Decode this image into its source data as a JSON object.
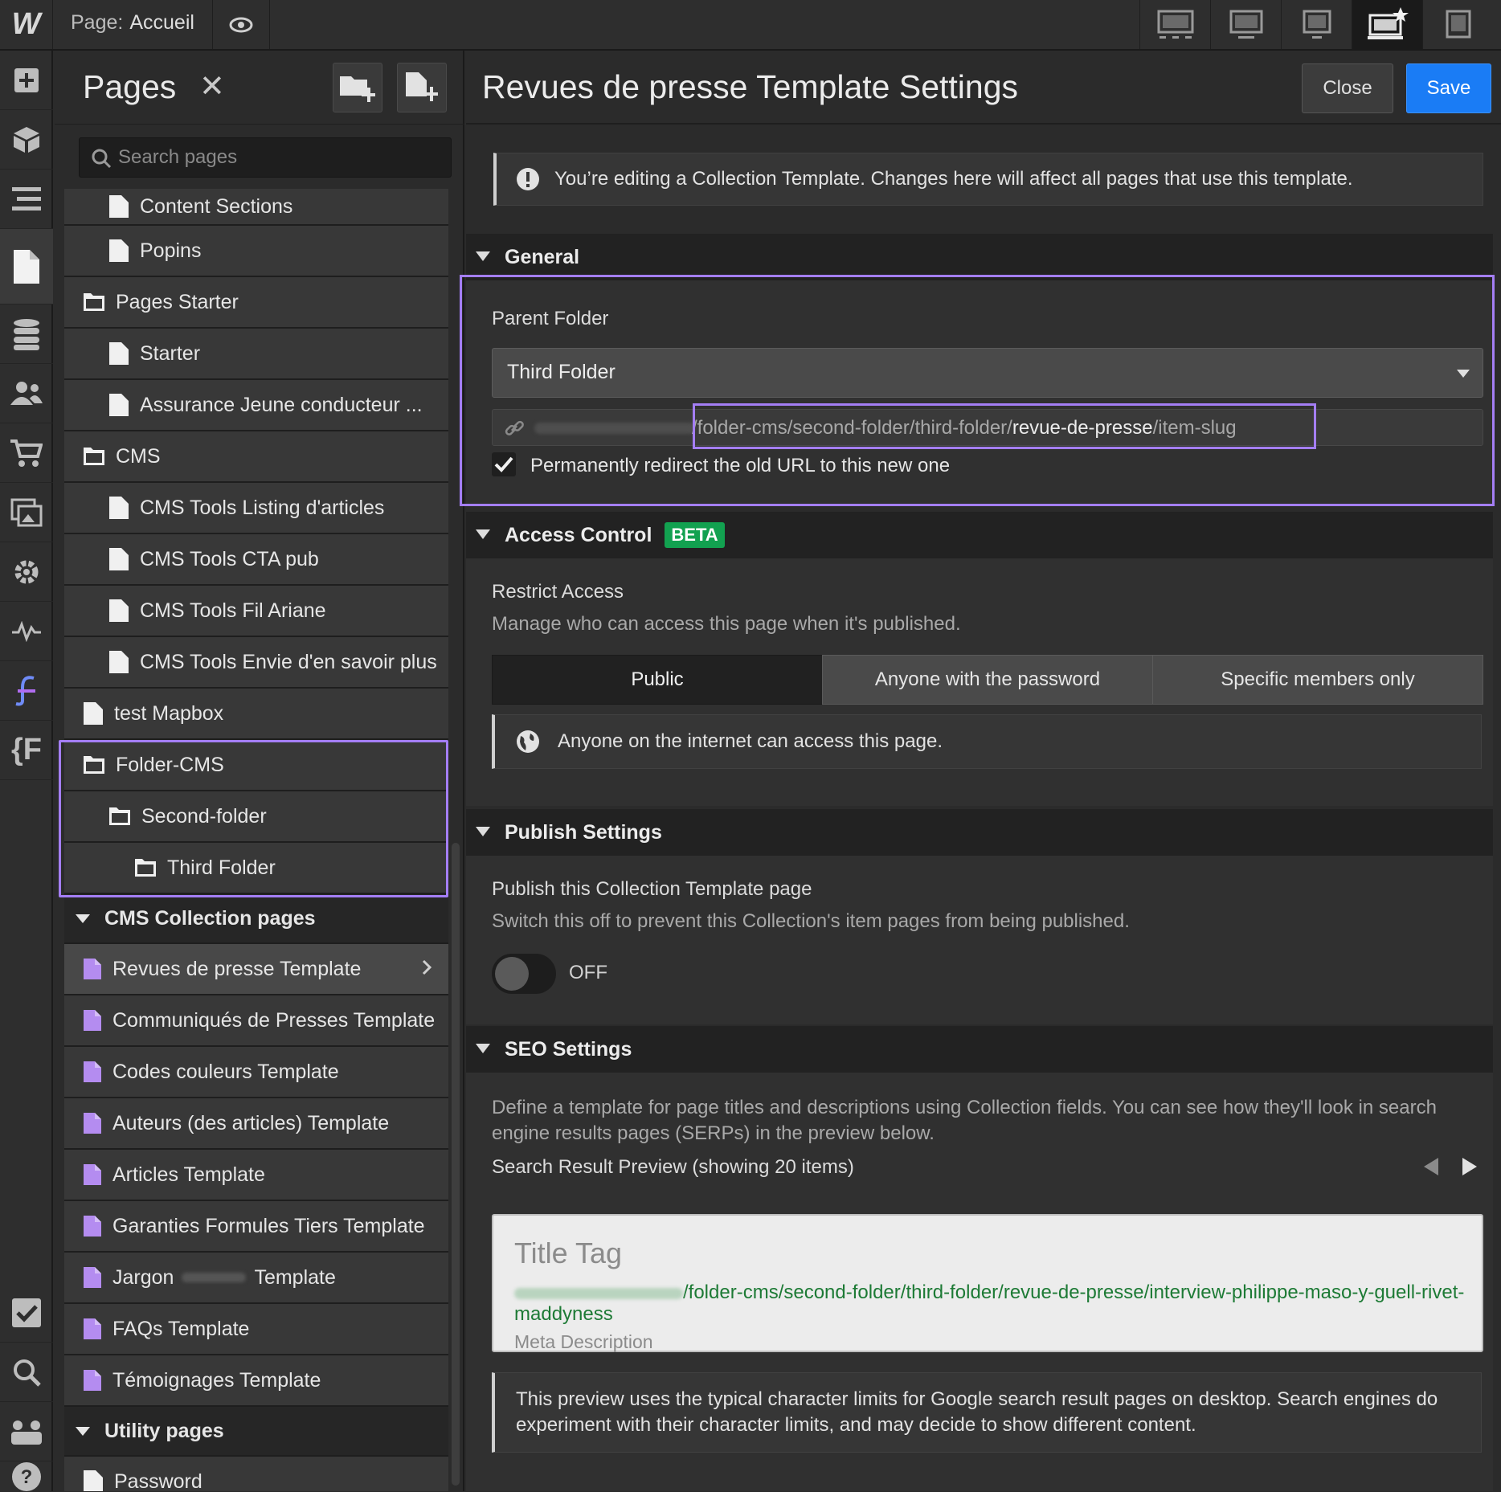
{
  "topbar": {
    "logo": "W",
    "page_prefix": "Page:",
    "page_name": "Accueil",
    "devices": [
      "desktop-icon",
      "tablet-landscape-icon",
      "tablet-icon",
      "base-desktop-icon",
      "mobile-icon"
    ]
  },
  "rail": [
    "add-icon",
    "cube-icon",
    "navigator-icon",
    "pages-icon",
    "cms-icon",
    "users-icon",
    "ecommerce-icon",
    "assets-icon",
    "settings-icon",
    "activity-icon",
    "finsweet-icon",
    "variables-icon",
    "tasks-icon",
    "search-icon",
    "collaborators-icon",
    "help-icon"
  ],
  "pages_panel": {
    "title": "Pages",
    "search_placeholder": "Search pages",
    "items": [
      {
        "label": "Content Sections",
        "type": "page",
        "indent": 2
      },
      {
        "label": "Popins",
        "type": "page",
        "indent": 2
      },
      {
        "label": "Pages Starter",
        "type": "folder",
        "indent": 1
      },
      {
        "label": "Starter",
        "type": "page",
        "indent": 2
      },
      {
        "label": "Assurance Jeune conducteur ...",
        "type": "page",
        "indent": 2
      },
      {
        "label": "CMS",
        "type": "folder",
        "indent": 1
      },
      {
        "label": "CMS Tools Listing d'articles",
        "type": "page",
        "indent": 2
      },
      {
        "label": "CMS Tools CTA pub",
        "type": "page",
        "indent": 2
      },
      {
        "label": "CMS Tools Fil Ariane",
        "type": "page",
        "indent": 2
      },
      {
        "label": "CMS Tools Envie d'en savoir plus",
        "type": "page",
        "indent": 2
      },
      {
        "label": "test Mapbox",
        "type": "page",
        "indent": 1
      },
      {
        "label": "Folder-CMS",
        "type": "folder",
        "indent": 1
      },
      {
        "label": "Second-folder",
        "type": "folder",
        "indent": 2
      },
      {
        "label": "Third Folder",
        "type": "folder",
        "indent": 3
      }
    ],
    "cms_section": "CMS Collection pages",
    "cms_items": [
      "Revues de presse Template",
      "Communiqués de Presses Template",
      "Codes couleurs Template",
      "Auteurs (des articles) Template",
      "Articles Template",
      "Garanties Formules Tiers Template",
      "Jargon",
      "FAQs Template",
      "Témoignages Template"
    ],
    "jargon_suffix": "Template",
    "utility_section": "Utility pages",
    "utility_items": [
      "Password"
    ]
  },
  "settings": {
    "title": "Revues de presse Template Settings",
    "close_label": "Close",
    "save_label": "Save",
    "notice": "You’re editing a Collection Template. Changes here will affect all pages that use this template.",
    "general": {
      "heading": "General",
      "parent_folder_label": "Parent Folder",
      "parent_folder_value": "Third Folder",
      "url_path": "/folder-cms/second-folder/third-folder/",
      "url_slug": "revue-de-presse",
      "url_tail": "/item-slug",
      "redirect_label": "Permanently redirect the old URL to this new one",
      "redirect_checked": true
    },
    "access": {
      "heading": "Access Control",
      "badge": "BETA",
      "label": "Restrict Access",
      "description": "Manage who can access this page when it's published.",
      "options": [
        "Public",
        "Anyone with the password",
        "Specific members only"
      ],
      "selected": "Public",
      "info": "Anyone on the internet can access this page."
    },
    "publish": {
      "heading": "Publish Settings",
      "label": "Publish this Collection Template page",
      "description": "Switch this off to prevent this Collection's item pages from being published.",
      "toggle_label": "OFF"
    },
    "seo": {
      "heading": "SEO Settings",
      "description": "Define a template for page titles and descriptions using Collection fields. You can see how they'll look in search engine results pages (SERPs) in the preview below.",
      "preview_label": "Search Result Preview (showing 20 items)",
      "serp_title": "Title Tag",
      "serp_url": "/folder-cms/second-folder/third-folder/revue-de-presse/interview-philippe-maso-y-guell-rivet-maddyness",
      "serp_desc": "Meta Description",
      "footnote": "This preview uses the typical character limits for Google search result pages on desktop. Search engines do experiment with their character limits, and may decide to show different content."
    }
  }
}
